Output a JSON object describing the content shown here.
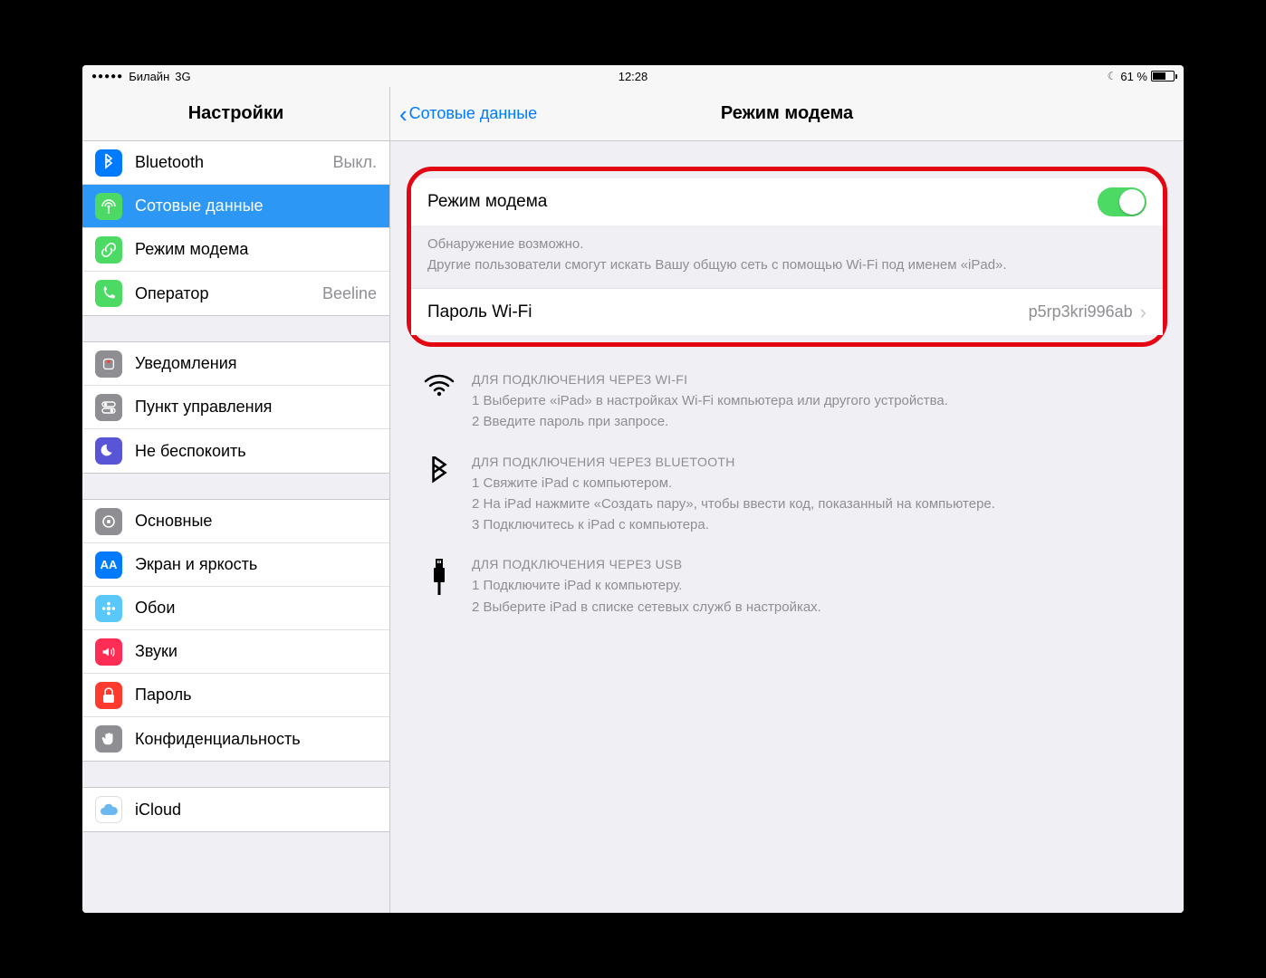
{
  "status": {
    "carrier": "Билайн",
    "network": "3G",
    "time": "12:28",
    "battery_pct": "61 %"
  },
  "sidebar": {
    "title": "Настройки",
    "groups": [
      [
        {
          "label": "Bluetooth",
          "value": "Выкл.",
          "icon_bg": "#007aff",
          "icon_glyph": "bt"
        },
        {
          "label": "Сотовые данные",
          "value": "",
          "icon_bg": "#4cd964",
          "icon_glyph": "antenna",
          "selected": true
        },
        {
          "label": "Режим модема",
          "value": "",
          "icon_bg": "#4cd964",
          "icon_glyph": "link"
        },
        {
          "label": "Оператор",
          "value": "Beeline",
          "icon_bg": "#4cd964",
          "icon_glyph": "phone"
        }
      ],
      [
        {
          "label": "Уведомления",
          "icon_bg": "#8e8e93",
          "icon_glyph": "bell"
        },
        {
          "label": "Пункт управления",
          "icon_bg": "#8e8e93",
          "icon_glyph": "switches"
        },
        {
          "label": "Не беспокоить",
          "icon_bg": "#5856d6",
          "icon_glyph": "moon"
        }
      ],
      [
        {
          "label": "Основные",
          "icon_bg": "#8e8e93",
          "icon_glyph": "gear"
        },
        {
          "label": "Экран и яркость",
          "icon_bg": "#007aff",
          "icon_glyph": "AA"
        },
        {
          "label": "Обои",
          "icon_bg": "#5ac8fa",
          "icon_glyph": "flower"
        },
        {
          "label": "Звуки",
          "icon_bg": "#ff2d55",
          "icon_glyph": "speaker"
        },
        {
          "label": "Пароль",
          "icon_bg": "#ff3b30",
          "icon_glyph": "lock"
        },
        {
          "label": "Конфиденциальность",
          "icon_bg": "#8e8e93",
          "icon_glyph": "hand"
        }
      ],
      [
        {
          "label": "iCloud",
          "icon_bg": "#ffffff",
          "icon_glyph": "cloud"
        }
      ]
    ]
  },
  "content": {
    "back_label": "Сотовые данные",
    "title": "Режим модема",
    "hotspot_label": "Режим модема",
    "hotspot_on": true,
    "footer_line1": "Обнаружение возможно.",
    "footer_line2": "Другие пользователи смогут искать Вашу общую сеть с помощью Wi-Fi под именем «iPad».",
    "wifi_pass_label": "Пароль Wi-Fi",
    "wifi_pass_value": "p5rp3kri996ab",
    "instructions": [
      {
        "icon": "wifi",
        "heading": "ДЛЯ ПОДКЛЮЧЕНИЯ ЧЕРЕЗ WI-FI",
        "lines": [
          "1 Выберите «iPad» в настройках Wi-Fi компьютера или другого устройства.",
          "2 Введите пароль при запросе."
        ]
      },
      {
        "icon": "bt",
        "heading": "ДЛЯ ПОДКЛЮЧЕНИЯ ЧЕРЕЗ BLUETOOTH",
        "lines": [
          "1 Свяжите iPad с компьютером.",
          "2 На iPad нажмите «Создать пару», чтобы ввести код, показанный на компьютере.",
          "3 Подключитесь к iPad с компьютера."
        ]
      },
      {
        "icon": "usb",
        "heading": "ДЛЯ ПОДКЛЮЧЕНИЯ ЧЕРЕЗ USB",
        "lines": [
          "1 Подключите iPad к компьютеру.",
          "2 Выберите iPad в списке сетевых служб в настройках."
        ]
      }
    ]
  }
}
